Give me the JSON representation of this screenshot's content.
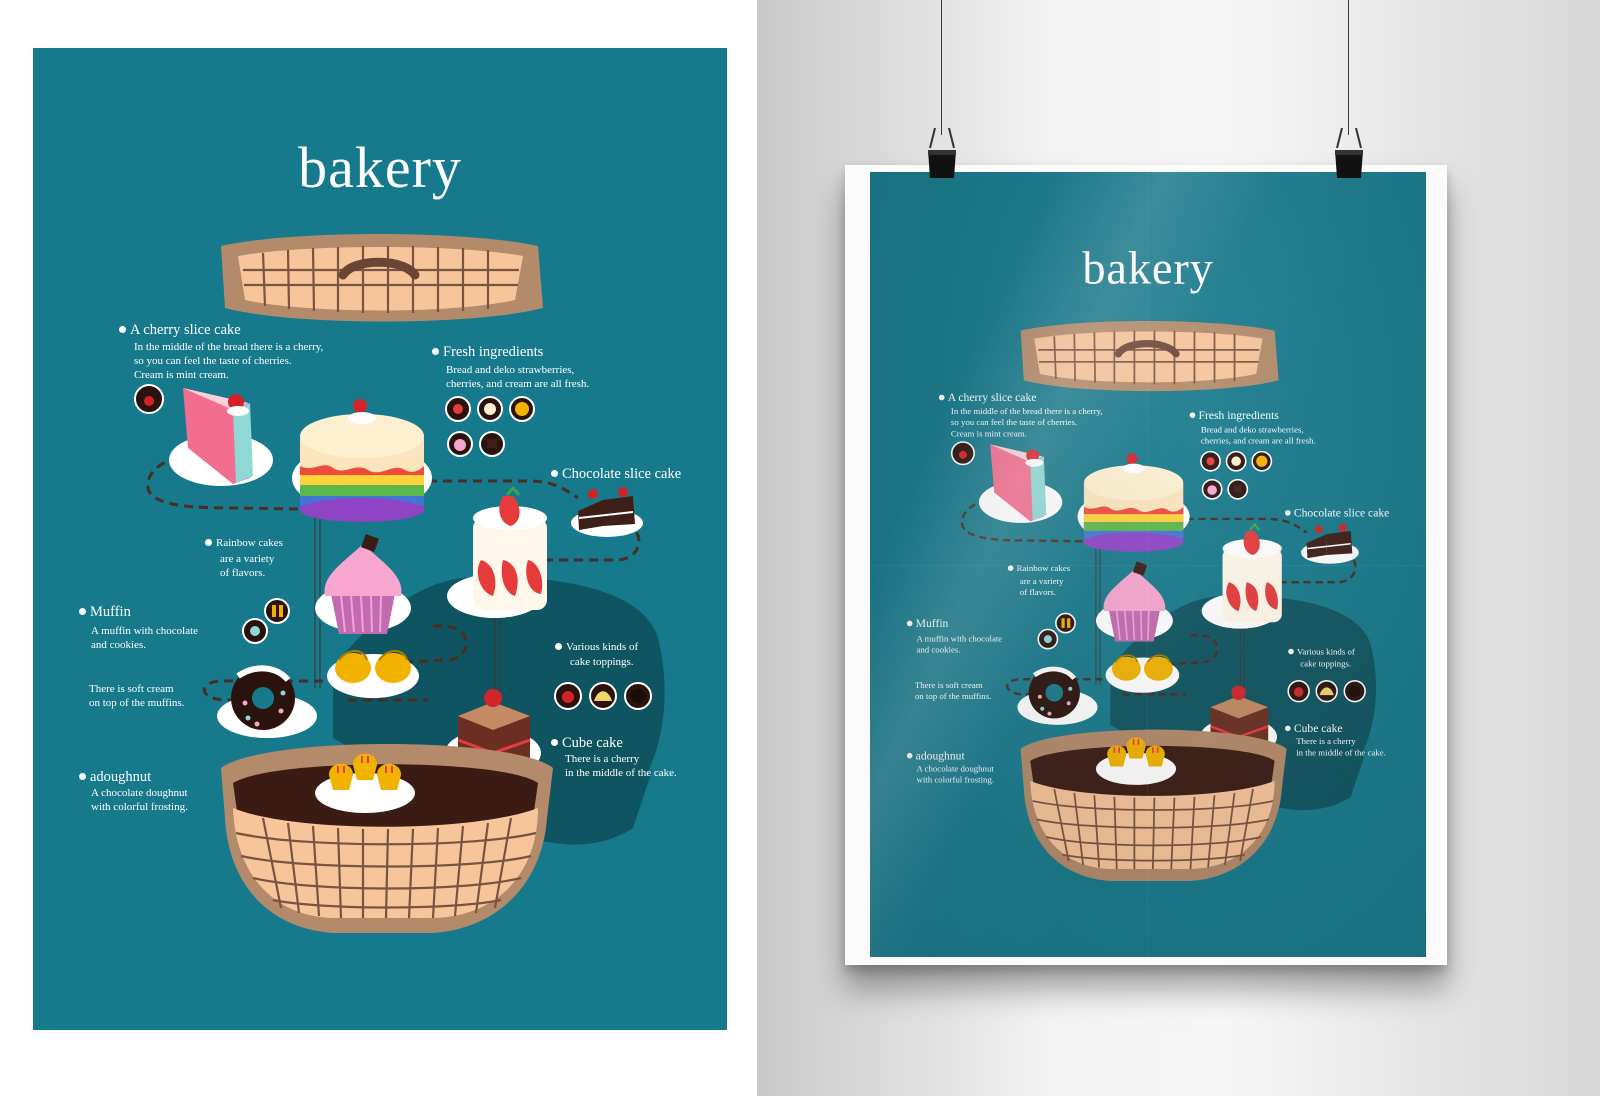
{
  "poster": {
    "title": "bakery",
    "sections": {
      "cherry": {
        "label": "A cherry slice cake",
        "lines": [
          "In the middle of the bread there is a cherry,",
          "so you can feel the taste of cherries.",
          "Cream is mint cream."
        ]
      },
      "fresh": {
        "label": "Fresh ingredients",
        "lines": [
          "Bread and deko strawberries,",
          "cherries, and cream are all fresh."
        ]
      },
      "chocolate": {
        "label": "Chocolate slice cake"
      },
      "rainbow": {
        "label": "Rainbow cakes",
        "lines": [
          "are a variety",
          "of flavors."
        ]
      },
      "muffin": {
        "label": "Muffin",
        "lines": [
          "A muffin with chocolate",
          "and cookies."
        ]
      },
      "cream": {
        "lines": [
          "There is soft cream",
          "on top of the muffins."
        ]
      },
      "toppings": {
        "label": "Various kinds of",
        "lines": [
          "cake toppings."
        ]
      },
      "cube": {
        "label": "Cube cake",
        "lines": [
          "There is a cherry",
          "in the middle of the cake."
        ]
      },
      "doughnut": {
        "label": "adoughnut",
        "lines": [
          "A chocolate doughnut",
          "with colorful frosting."
        ]
      }
    },
    "colors": {
      "background": "#177a8c",
      "shadow": "#0f5561",
      "basket": "#f8c49a",
      "basket_rim": "#b38a6a",
      "plate": "#ffffff"
    }
  }
}
